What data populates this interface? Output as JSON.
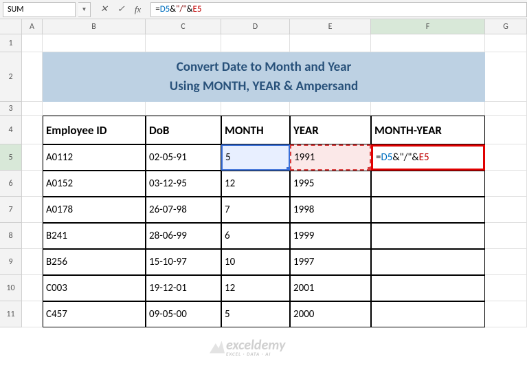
{
  "name_box": "SUM",
  "formula_bar": {
    "eq": "=",
    "ref1": "D5",
    "amp1": "&",
    "str": "\"/\"",
    "amp2": "&",
    "ref2": "E5"
  },
  "columns": [
    "A",
    "B",
    "C",
    "D",
    "E",
    "F",
    "G"
  ],
  "rows": [
    "1",
    "2",
    "3",
    "4",
    "5",
    "6",
    "7",
    "8",
    "9",
    "10",
    "11"
  ],
  "title_line1": "Convert Date to Month and Year",
  "title_line2": "Using MONTH, YEAR & Ampersand",
  "headers": {
    "b": "Employee ID",
    "c": "DoB",
    "d": "MONTH",
    "e": "YEAR",
    "f": "MONTH-YEAR"
  },
  "data_rows": [
    {
      "id": "A0112",
      "dob": "02-05-91",
      "month": "5",
      "year": "1991"
    },
    {
      "id": "A0152",
      "dob": "03-12-95",
      "month": "12",
      "year": "1995"
    },
    {
      "id": "A0178",
      "dob": "26-07-98",
      "month": "7",
      "year": "1998"
    },
    {
      "id": "B241",
      "dob": "28-06-99",
      "month": "6",
      "year": "1999"
    },
    {
      "id": "B256",
      "dob": "15-10-97",
      "month": "10",
      "year": "1997"
    },
    {
      "id": "C003",
      "dob": "19-12-01",
      "month": "12",
      "year": "2001"
    },
    {
      "id": "C457",
      "dob": "09-05-00",
      "month": "5",
      "year": "2000"
    }
  ],
  "f5_edit": {
    "eq": "=",
    "ref1": "D5",
    "amp1": "&",
    "str": "\"/\"",
    "amp2": "&",
    "ref2": "E5"
  },
  "watermark": {
    "text": "exceldemy",
    "sub": "EXCEL · DATA · AI"
  }
}
